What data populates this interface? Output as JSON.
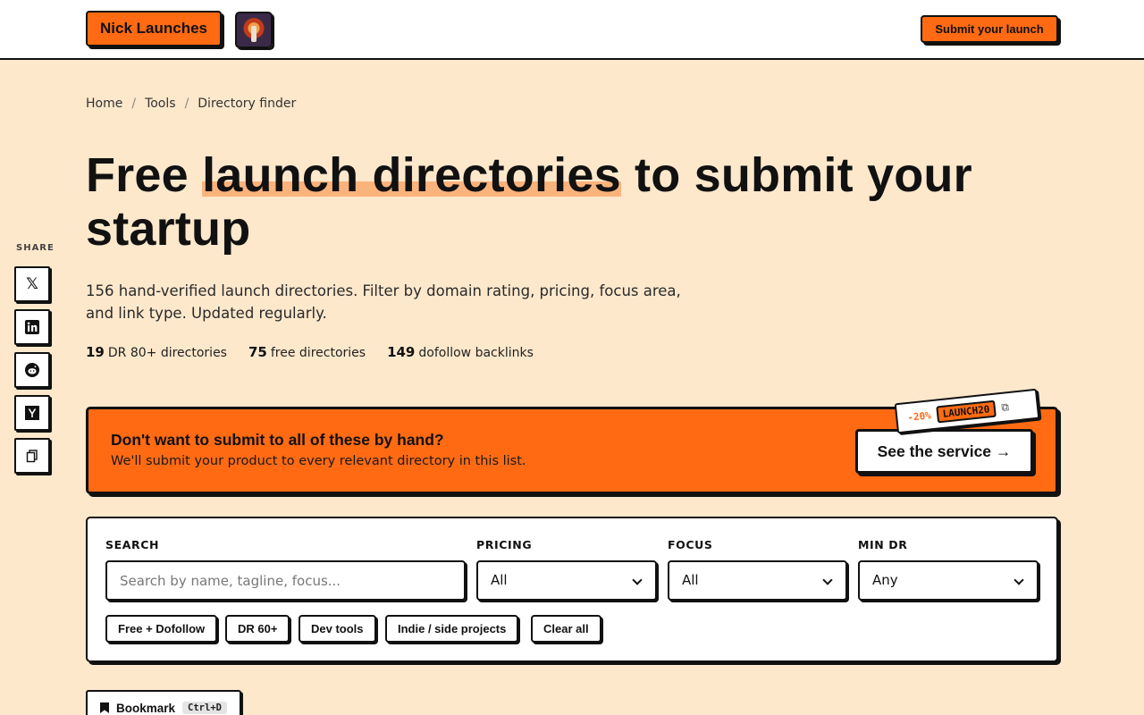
{
  "header": {
    "brand": "Nick Launches",
    "submit_label": "Submit your launch"
  },
  "breadcrumb": {
    "home": "Home",
    "tools": "Tools",
    "current": "Directory finder",
    "separator": "/"
  },
  "hero": {
    "title_pre": "Free ",
    "title_highlight": "launch directories",
    "title_post": " to submit your startup",
    "lede": "156 hand-verified launch directories. Filter by domain rating, pricing, focus area, and link type. Updated regularly."
  },
  "stats": [
    {
      "value": "19",
      "label": "DR 80+ directories"
    },
    {
      "value": "75",
      "label": "free directories"
    },
    {
      "value": "149",
      "label": "dofollow backlinks"
    }
  ],
  "share": {
    "label": "SHARE",
    "items": [
      "x-icon",
      "linkedin-icon",
      "reddit-icon",
      "hackernews-icon",
      "copy-link-icon"
    ]
  },
  "promo": {
    "title": "Don't want to submit to all of these by hand?",
    "subtitle": "We'll submit your product to every relevant directory in this list.",
    "cta": "See the service →",
    "coupon_discount": "-20%",
    "coupon_code": "LAUNCH20"
  },
  "filters": {
    "search_label": "SEARCH",
    "search_placeholder": "Search by name, tagline, focus...",
    "pricing_label": "PRICING",
    "pricing_value": "All",
    "focus_label": "FOCUS",
    "focus_value": "All",
    "min_dr_label": "MIN DR",
    "min_dr_value": "Any",
    "chips": [
      "Free + Dofollow",
      "DR 60+",
      "Dev tools",
      "Indie / side projects",
      "Clear all"
    ]
  },
  "bookmark": {
    "label": "Bookmark",
    "shortcut": "Ctrl+D"
  },
  "colors": {
    "accent": "#ff6a13",
    "background": "#fde8cc",
    "highlight": "#fbb37c"
  }
}
